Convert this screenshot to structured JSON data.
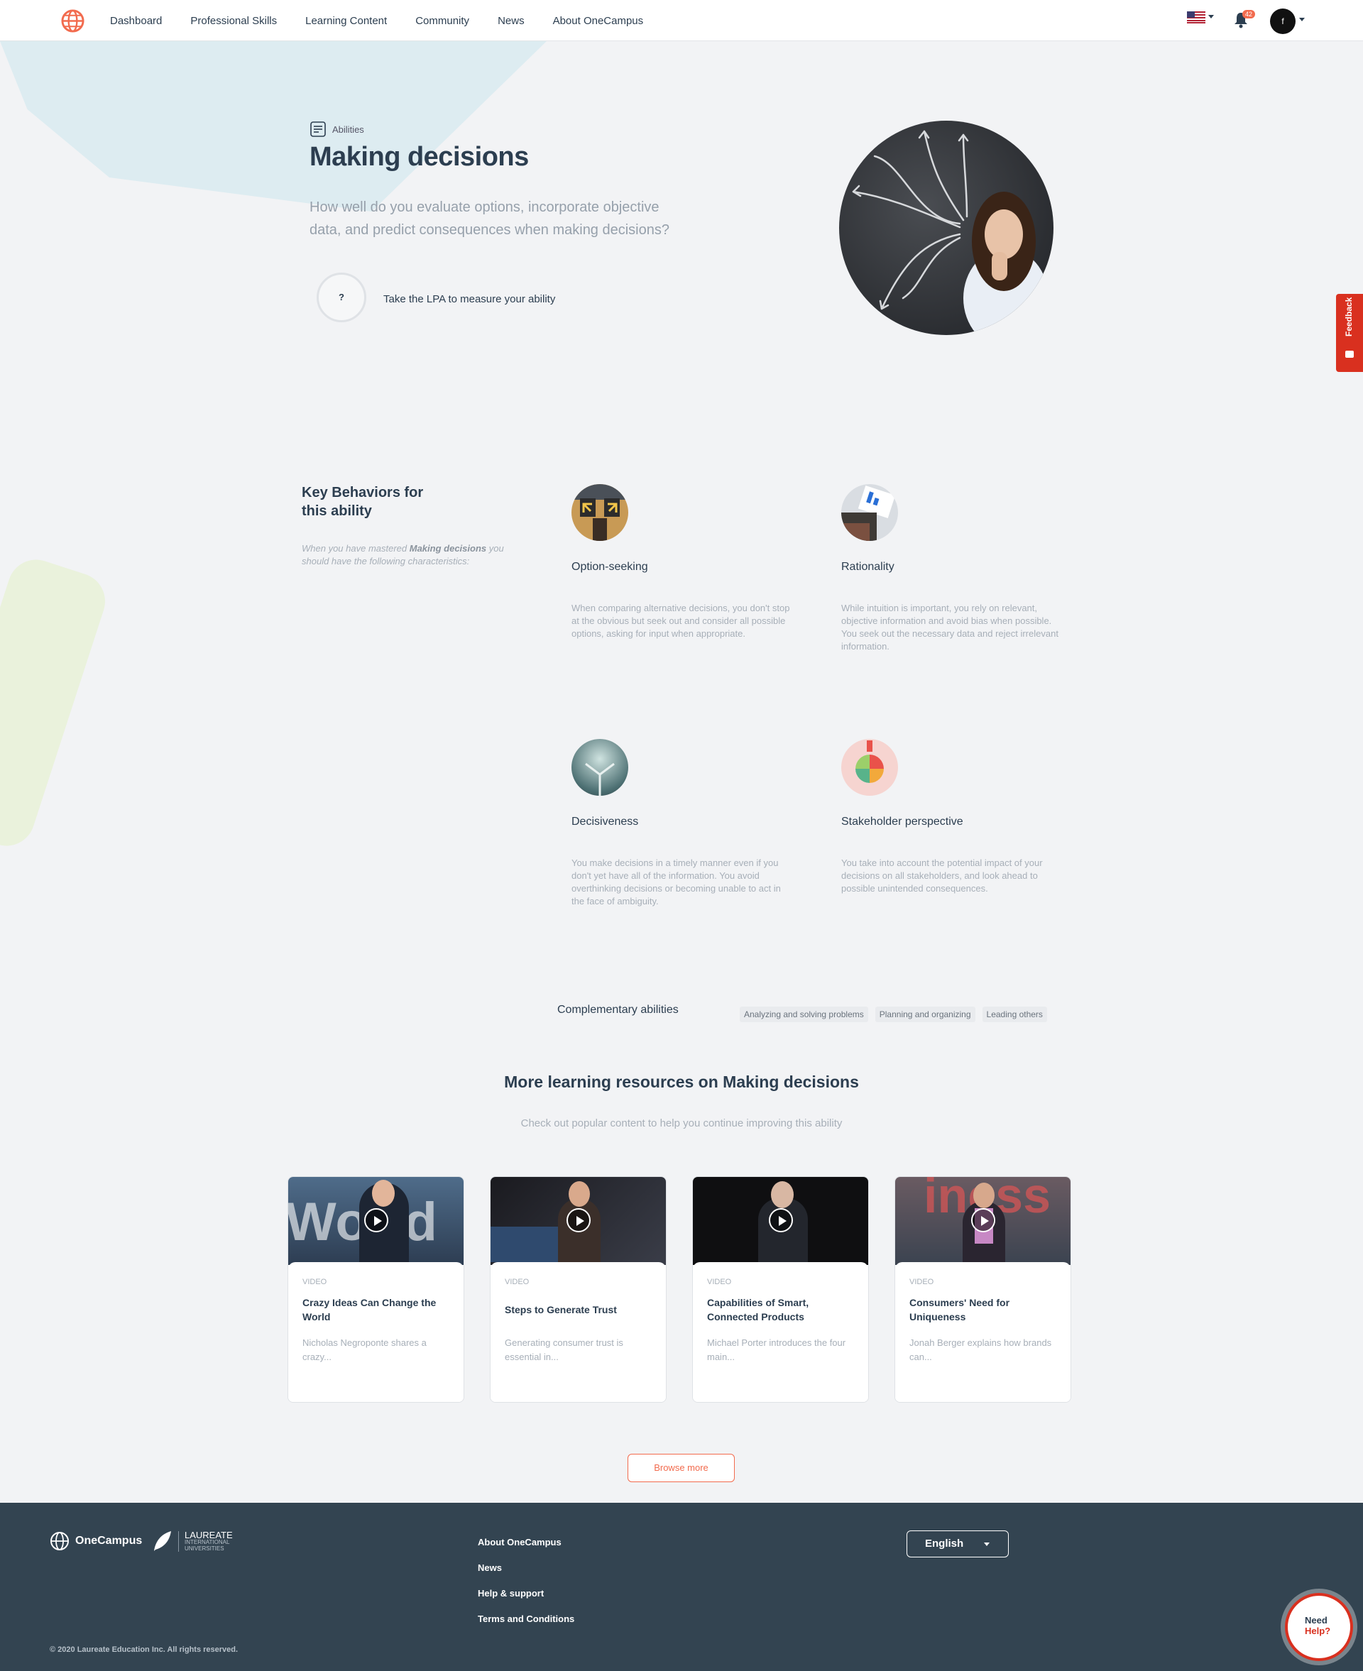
{
  "nav": {
    "items": [
      "Dashboard",
      "Professional Skills",
      "Learning Content",
      "Community",
      "News",
      "About OneCampus"
    ],
    "notifications": "42",
    "avatar_initial": "f"
  },
  "hero": {
    "category": "Abilities",
    "title": "Making decisions",
    "description": "How well do you evaluate options, incorporate objective data, and predict consequences when making decisions?",
    "lpa_symbol": "?",
    "lpa_text": "Take the LPA to measure your ability"
  },
  "feedback_label": "Feedback",
  "key_behaviors": {
    "title": "Key Behaviors for this ability",
    "sub_prefix": "When you have mastered ",
    "sub_bold": "Making decisions",
    "sub_suffix": " you should have the following characteristics:",
    "items": [
      {
        "title": "Option-seeking",
        "description": "When comparing alternative decisions, you don't stop at the obvious but seek out and consider all possible options, asking for input when appropriate.",
        "icon": "arrows-signs-icon"
      },
      {
        "title": "Rationality",
        "description": "While intuition is important, you rely on relevant, objective information and avoid bias when possible. You seek out the necessary data and reject irrelevant information.",
        "icon": "laptop-charts-icon"
      },
      {
        "title": "Decisiveness",
        "description": "You make decisions in a timely manner even if you don't yet have all of the information. You avoid overthinking decisions or becoming unable to act in the face of ambiguity.",
        "icon": "crossroad-icon"
      },
      {
        "title": "Stakeholder perspective",
        "description": "You take into account the potential impact of your decisions on all stakeholders, and look ahead to possible unintended consequences.",
        "icon": "stakeholder-wheel-icon"
      }
    ]
  },
  "complementary": {
    "label": "Complementary abilities",
    "tags": [
      "Analyzing and solving problems",
      "Planning and organizing",
      "Leading others"
    ]
  },
  "resources": {
    "title": "More learning resources on Making decisions",
    "subtitle": "Check out popular content to help you continue improving this ability",
    "cards": [
      {
        "type": "VIDEO",
        "title": "Crazy Ideas Can Change the World",
        "description": "Nicholas Negroponte shares a crazy...",
        "overlay": "World"
      },
      {
        "type": "VIDEO",
        "title": "Steps to Generate Trust",
        "description": "Generating consumer trust is essential in...",
        "overlay": ""
      },
      {
        "type": "VIDEO",
        "title": "Capabilities of Smart, Connected Products",
        "description": "Michael Porter introduces the four main...",
        "overlay": ""
      },
      {
        "type": "VIDEO",
        "title": "Consumers' Need for Uniqueness",
        "description": "Jonah Berger explains how brands can...",
        "overlay": "iness"
      }
    ],
    "browse_label": "Browse more"
  },
  "footer": {
    "brand": "OneCampus",
    "laureate": "LAUREATE",
    "laureate_sub1": "INTERNATIONAL",
    "laureate_sub2": "UNIVERSITIES",
    "links": [
      "About OneCampus",
      "News",
      "Help & support",
      "Terms and Conditions"
    ],
    "language": "English",
    "copyright": "© 2020 Laureate Education Inc. All rights reserved.",
    "help_line1": "Need",
    "help_line2": "Help?"
  }
}
